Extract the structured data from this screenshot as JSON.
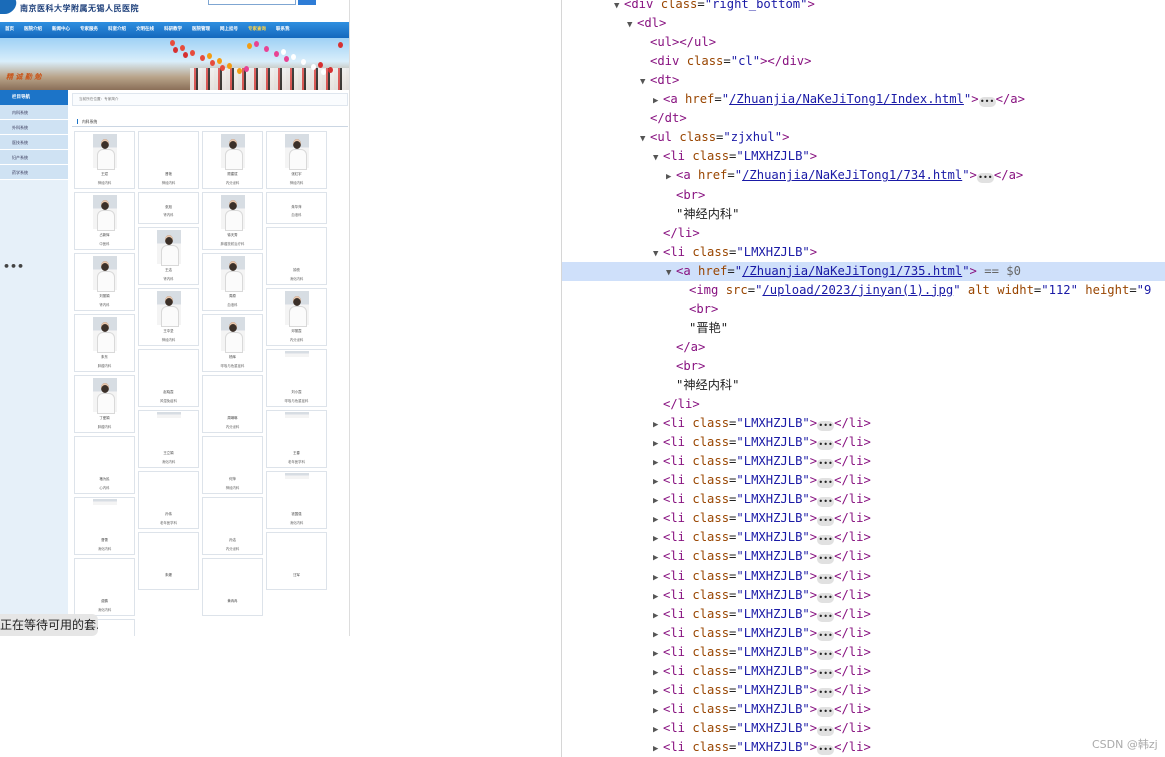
{
  "site": {
    "title": "南京医科大学附属无锡人民医院",
    "nav": [
      "首页",
      "医院介绍",
      "新闻中心",
      "专家服务",
      "科室介绍",
      "文明在线",
      "科研教学",
      "医院管理",
      "网上挂号",
      "专家查询",
      "联系我"
    ],
    "active_nav_index": 9,
    "slogan": "精 诚 勤 勉",
    "sidebar_title": "栏目导航",
    "sidebar_items": [
      "内科系统",
      "外科系统",
      "医技系统",
      "妇产系统",
      "药学系统"
    ],
    "breadcrumb": "当前所在位置：专家简介",
    "section_title": "内科系统",
    "doctors": [
      {
        "name": "王斌",
        "dept": "神经内科",
        "photo": true
      },
      {
        "name": "晋艳",
        "dept": "神经内科",
        "photo": false
      },
      {
        "name": "顾建斌",
        "dept": "内分泌科",
        "photo": true
      },
      {
        "name": "张红宇",
        "dept": "神经内科",
        "photo": true
      },
      {
        "name": "占新辉",
        "dept": "中医科",
        "photo": true
      },
      {
        "name": "张旭",
        "dept": "肾内科",
        "photo": false
      },
      {
        "name": "徐天秀",
        "dept": "肿瘤放射治疗科",
        "photo": true
      },
      {
        "name": "朱华萍",
        "dept": "血液科",
        "photo": false
      },
      {
        "name": "刘丽娟",
        "dept": "肾内科",
        "photo": true
      },
      {
        "name": "王洁",
        "dept": "肾内科",
        "photo": true
      },
      {
        "name": "周原",
        "dept": "血液科",
        "photo": true
      },
      {
        "name": "钟亮",
        "dept": "消化内科",
        "photo": false
      },
      {
        "name": "朱东",
        "dept": "肿瘤内科",
        "photo": true
      },
      {
        "name": "王中坚",
        "dept": "神经内科",
        "photo": true
      },
      {
        "name": "杨辉",
        "dept": "呼吸与危重症科",
        "photo": true
      },
      {
        "name": "邓丽霞",
        "dept": "内分泌科",
        "photo": true
      },
      {
        "name": "丁爱娟",
        "dept": "肿瘤内科",
        "photo": true
      },
      {
        "name": "赵晓霞",
        "dept": "风湿免疫科",
        "photo": false
      },
      {
        "name": "周琳琳",
        "dept": "内分泌科",
        "photo": false
      },
      {
        "name": "刘小霞",
        "dept": "呼吸与危重症科",
        "photo": "small"
      },
      {
        "name": "褚为民",
        "dept": "心内科",
        "photo": false
      },
      {
        "name": "王立娟",
        "dept": "消化内科",
        "photo": "small"
      },
      {
        "name": "何萍",
        "dept": "神经内科",
        "photo": false
      },
      {
        "name": "王春",
        "dept": "老年医学科",
        "photo": "small"
      },
      {
        "name": "曹蕾",
        "dept": "消化内科",
        "photo": "small"
      },
      {
        "name": "孙伟",
        "dept": "老年医学科",
        "photo": false
      },
      {
        "name": "孙洁",
        "dept": "内分泌科",
        "photo": false
      },
      {
        "name": "钱国强",
        "dept": "消化内科",
        "photo": "small"
      },
      {
        "name": "费鹏",
        "dept": "消化内科",
        "photo": false
      },
      {
        "name": "朱姗",
        "dept": "",
        "photo": false
      },
      {
        "name": "黄冉冉",
        "dept": "",
        "photo": false
      },
      {
        "name": "汪军",
        "dept": "",
        "photo": false
      },
      {
        "name": "许玲玲",
        "dept": "",
        "photo": false
      }
    ]
  },
  "toast": "正在等待可用的套...",
  "devtools": {
    "lines": [
      {
        "indent": 4,
        "arrow": "down",
        "html": "<span class=\"tag\">&lt;div</span> <span class=\"attr\">class</span>=<span class=\"val\">\"right_bottom\"</span><span class=\"tag\">&gt;</span>"
      },
      {
        "indent": 5,
        "arrow": "down",
        "html": "<span class=\"tag\">&lt;dl&gt;</span>"
      },
      {
        "indent": 6,
        "arrow": "",
        "html": "<span class=\"tag\">&lt;ul&gt;&lt;/ul&gt;</span>"
      },
      {
        "indent": 6,
        "arrow": "",
        "html": "<span class=\"tag\">&lt;div</span> <span class=\"attr\">class</span>=<span class=\"val\">\"cl\"</span><span class=\"tag\">&gt;&lt;/div&gt;</span>"
      },
      {
        "indent": 6,
        "arrow": "down",
        "html": "<span class=\"tag\">&lt;dt&gt;</span>"
      },
      {
        "indent": 7,
        "arrow": "right",
        "html": "<span class=\"tag\">&lt;a</span> <span class=\"attr\">href</span>=<span class=\"val\">\"<span class=\"link\">/Zhuanjia/NaKeJiTong1/Index.html</span>\"</span><span class=\"tag\">&gt;</span><span class=\"ell\">•••</span><span class=\"tag\">&lt;/a&gt;</span>"
      },
      {
        "indent": 6,
        "arrow": "",
        "html": "<span class=\"tag\">&lt;/dt&gt;</span>"
      },
      {
        "indent": 6,
        "arrow": "down",
        "html": "<span class=\"tag\">&lt;ul</span> <span class=\"attr\">class</span>=<span class=\"val\">\"zjxhul\"</span><span class=\"tag\">&gt;</span>"
      },
      {
        "indent": 7,
        "arrow": "down",
        "html": "<span class=\"tag\">&lt;li</span> <span class=\"attr\">class</span>=<span class=\"val\">\"LMXHZJLB\"</span><span class=\"tag\">&gt;</span>"
      },
      {
        "indent": 8,
        "arrow": "right",
        "html": "<span class=\"tag\">&lt;a</span> <span class=\"attr\">href</span>=<span class=\"val\">\"<span class=\"link\">/Zhuanjia/NaKeJiTong1/734.html</span>\"</span><span class=\"tag\">&gt;</span><span class=\"ell\">•••</span><span class=\"tag\">&lt;/a&gt;</span>"
      },
      {
        "indent": 8,
        "arrow": "",
        "html": "<span class=\"tag\">&lt;br&gt;</span>"
      },
      {
        "indent": 8,
        "arrow": "",
        "html": "<span class=\"txt\">\"神经内科\"</span>"
      },
      {
        "indent": 7,
        "arrow": "",
        "html": "<span class=\"tag\">&lt;/li&gt;</span>"
      },
      {
        "indent": 7,
        "arrow": "down",
        "html": "<span class=\"tag\">&lt;li</span> <span class=\"attr\">class</span>=<span class=\"val\">\"LMXHZJLB\"</span><span class=\"tag\">&gt;</span>"
      },
      {
        "indent": 8,
        "arrow": "down",
        "hl": true,
        "html": "<span class=\"tag\">&lt;a</span> <span class=\"attr\">href</span>=<span class=\"val\">\"<span class=\"link\">/Zhuanjia/NaKeJiTong1/735.html</span>\"</span><span class=\"tag\">&gt;</span> <span class=\"dollar\">== $0</span>"
      },
      {
        "indent": 9,
        "arrow": "",
        "html": "<span class=\"tag\">&lt;img</span> <span class=\"attr\">src</span>=<span class=\"val\">\"<span class=\"link\">/upload/2023/jinyan(1).jpg</span>\"</span> <span class=\"attr\">alt</span> <span class=\"attr\">widht</span>=<span class=\"val\">\"112\"</span> <span class=\"attr\">height</span>=<span class=\"val\">\"9</span>"
      },
      {
        "indent": 9,
        "arrow": "",
        "html": "<span class=\"tag\">&lt;br&gt;</span>"
      },
      {
        "indent": 9,
        "arrow": "",
        "html": "<span class=\"txt\">\"晋艳\"</span>"
      },
      {
        "indent": 8,
        "arrow": "",
        "html": "<span class=\"tag\">&lt;/a&gt;</span>"
      },
      {
        "indent": 8,
        "arrow": "",
        "html": "<span class=\"tag\">&lt;br&gt;</span>"
      },
      {
        "indent": 8,
        "arrow": "",
        "html": "<span class=\"txt\">\"神经内科\"</span>"
      },
      {
        "indent": 7,
        "arrow": "",
        "html": "<span class=\"tag\">&lt;/li&gt;</span>"
      }
    ],
    "collapsed_li": "<span class=\"tag\">&lt;li</span> <span class=\"attr\">class</span>=<span class=\"val\">\"LMXHZJLB\"</span><span class=\"tag\">&gt;</span><span class=\"ell\">•••</span><span class=\"tag\">&lt;/li&gt;</span>",
    "collapsed_li_count": 18
  },
  "watermark": "CSDN @韩zj"
}
